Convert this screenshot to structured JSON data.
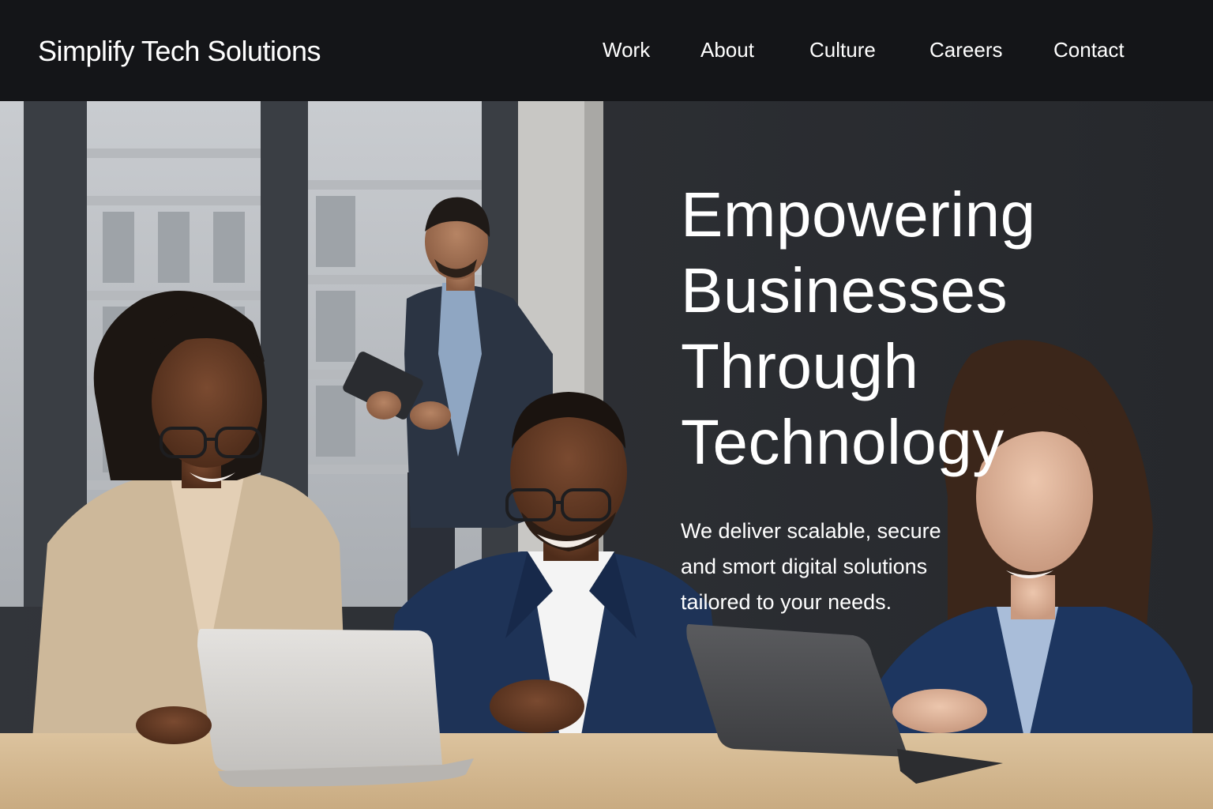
{
  "brand": "Simplify Tech Solutions",
  "nav": {
    "items": [
      {
        "label": "Work"
      },
      {
        "label": "About"
      },
      {
        "label": "Culture"
      },
      {
        "label": "Careers"
      },
      {
        "label": "Contact"
      }
    ]
  },
  "hero": {
    "title_lines": [
      "Empowering",
      "Businesses",
      "Through",
      "Technology"
    ],
    "subtitle_lines": [
      "We deliver scalable, secure",
      "and smort digital solutions",
      "tailored to your needs."
    ]
  },
  "colors": {
    "nav_background": "#141518",
    "text": "#ffffff",
    "wall": "#2b2d31",
    "table": "#d8bf98"
  }
}
